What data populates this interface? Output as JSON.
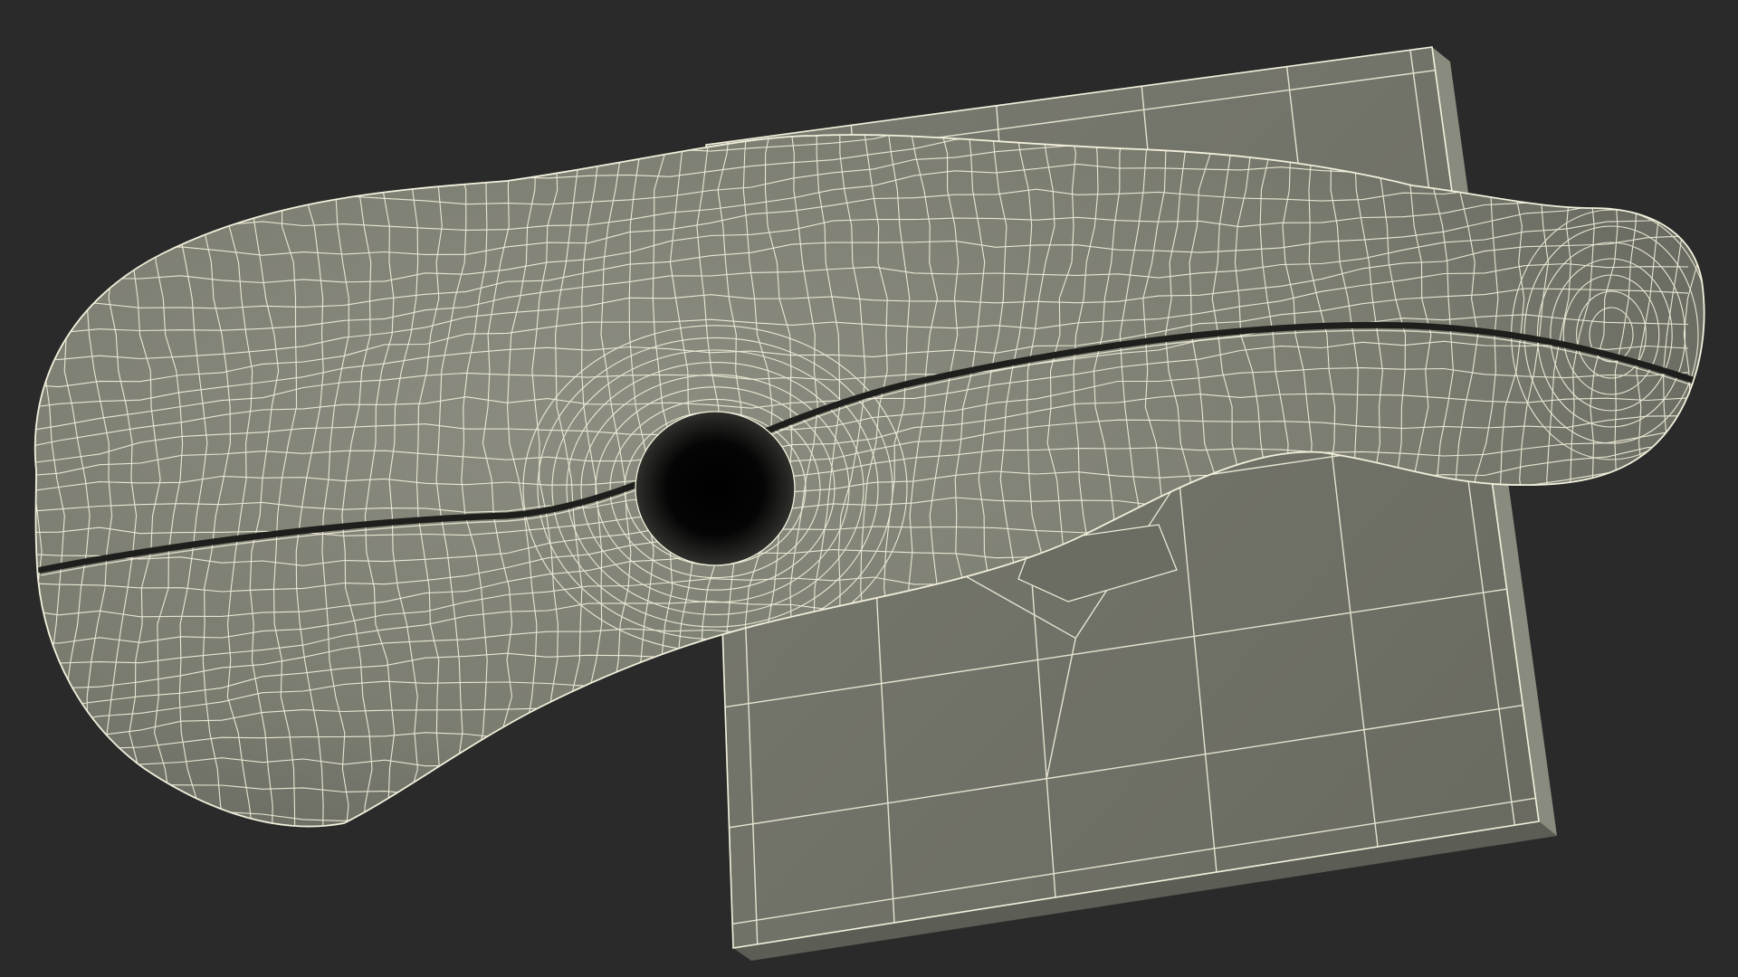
{
  "scene": {
    "subject": "wireframe-mesh-render",
    "colors": {
      "background": "#2a2a2a",
      "surface": "#7d7e72",
      "surface_light": "#8f907f",
      "surface_dark": "#62635a",
      "board": "#717267",
      "board_edge": "#85867a",
      "wire": "#f2f0dc",
      "cavity": "#050505"
    }
  }
}
